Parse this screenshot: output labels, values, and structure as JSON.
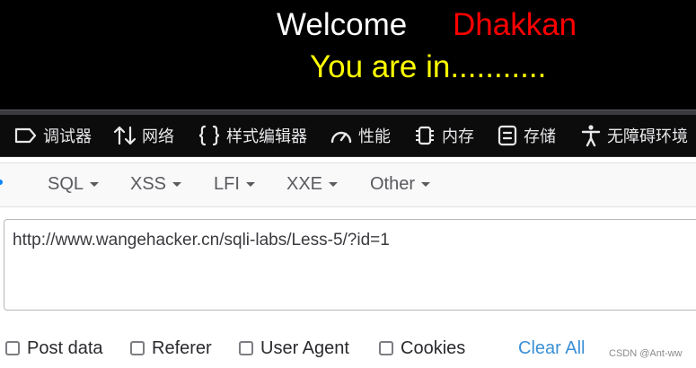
{
  "webpage": {
    "welcome_label": "Welcome",
    "username": "Dhakkan",
    "status_message": "You are in...........",
    "colors": {
      "background": "#000000",
      "welcome": "#ffffff",
      "username": "#ff0000",
      "status": "#ffff00"
    }
  },
  "devtools": {
    "tabs": [
      {
        "label": "调试器",
        "icon": "debugger-icon"
      },
      {
        "label": "网络",
        "icon": "network-arrows-icon"
      },
      {
        "label": "样式编辑器",
        "icon": "curly-braces-icon"
      },
      {
        "label": "性能",
        "icon": "gauge-icon"
      },
      {
        "label": "内存",
        "icon": "memory-chip-icon"
      },
      {
        "label": "存储",
        "icon": "storage-icon"
      },
      {
        "label": "无障碍环境",
        "icon": "accessibility-icon"
      }
    ]
  },
  "hackbar": {
    "menu": [
      {
        "label": "SQL"
      },
      {
        "label": "XSS"
      },
      {
        "label": "LFI"
      },
      {
        "label": "XXE"
      },
      {
        "label": "Other"
      }
    ],
    "url_value": "http://www.wangehacker.cn/sqli-labs/Less-5/?id=1",
    "options": [
      {
        "label": "Post data",
        "checked": false
      },
      {
        "label": "Referer",
        "checked": false
      },
      {
        "label": "User Agent",
        "checked": false
      },
      {
        "label": "Cookies",
        "checked": false
      }
    ],
    "clear_all_label": "Clear All"
  },
  "watermark": "CSDN @Ant-ww"
}
